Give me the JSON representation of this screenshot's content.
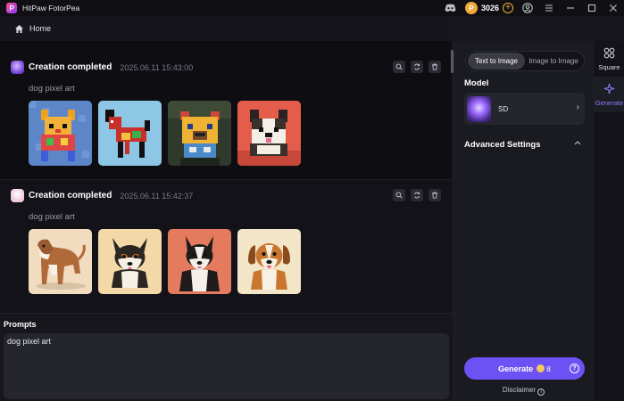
{
  "app": {
    "name": "HitPaw FotorPea",
    "logo_letter": "P"
  },
  "titlebar": {
    "credits": "3026",
    "coin_icon": "coin-icon",
    "icons": [
      "discord-icon",
      "add-credits-icon",
      "user-icon",
      "menu-icon",
      "minimize-icon",
      "maximize-icon",
      "close-icon"
    ]
  },
  "nav": {
    "home_label": "Home"
  },
  "feed": {
    "cards": [
      {
        "title": "Creation completed",
        "date": "2025.06.11  15:43:00",
        "prompt": "dog pixel art",
        "images": [
          "pixel-dog-blue",
          "pixel-dog-red",
          "pixel-dog-bulldog",
          "pixel-dog-terrier"
        ]
      },
      {
        "title": "Creation completed",
        "date": "2025.06.11  15:42:37",
        "prompt": "dog pixel art",
        "images": [
          "dog-standing",
          "dog-corgi-sitting",
          "dog-collie-sitting",
          "dog-puppy-sitting"
        ]
      }
    ]
  },
  "prompts": {
    "label": "Prompts",
    "value": "dog pixel art"
  },
  "panel": {
    "modes": [
      "Text to Image",
      "Image to Image"
    ],
    "active_mode": "Text to Image",
    "model_label": "Model",
    "model_name": "SD",
    "advanced_label": "Advanced Settings",
    "generate_label": "Generate",
    "generate_cost": "8",
    "disclaimer": "Disclaimer"
  },
  "rail": {
    "items": [
      {
        "label": "Square",
        "icon": "square-grid-icon"
      },
      {
        "label": "Generate",
        "icon": "sparkle-icon",
        "active": true
      }
    ]
  },
  "colors": {
    "accent": "#6c52f5",
    "coin": "#f2a93b",
    "background": "#0d0d12"
  }
}
